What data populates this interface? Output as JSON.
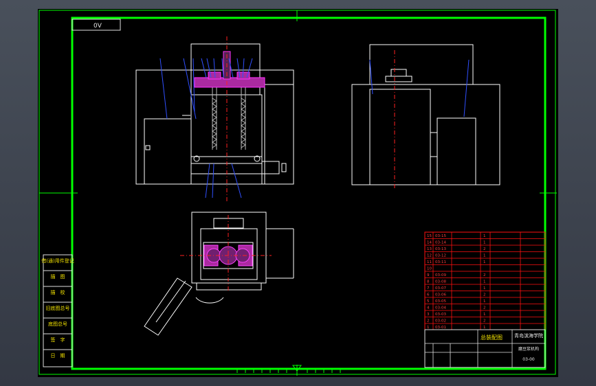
{
  "drawing_tag": "0V",
  "left_labels": [
    "借(通)用件登记",
    "描　图",
    "描　校",
    "旧底图总号",
    "底图总号",
    "签　字",
    "日　期"
  ],
  "bom_header": "总装配图",
  "school": "青岛滨海学院",
  "product": "磨豆浆机构",
  "drawing_no": "03-00",
  "bom_rows": [
    {
      "no": "15",
      "code": "03-15",
      "qty": "1"
    },
    {
      "no": "14",
      "code": "03-14",
      "qty": "1"
    },
    {
      "no": "13",
      "code": "03-13",
      "qty": "2"
    },
    {
      "no": "12",
      "code": "03-12",
      "qty": "1"
    },
    {
      "no": "11",
      "code": "03-11",
      "qty": "1"
    },
    {
      "no": "10",
      "code": "",
      "qty": ""
    },
    {
      "no": "9",
      "code": "03-09",
      "qty": "2"
    },
    {
      "no": "8",
      "code": "03-08",
      "qty": "1"
    },
    {
      "no": "7",
      "code": "03-07",
      "qty": "1"
    },
    {
      "no": "6",
      "code": "03-06",
      "qty": "2"
    },
    {
      "no": "5",
      "code": "03-05",
      "qty": "1"
    },
    {
      "no": "4",
      "code": "03-04",
      "qty": "2"
    },
    {
      "no": "3",
      "code": "03-03",
      "qty": "1"
    },
    {
      "no": "2",
      "code": "03-02",
      "qty": "2"
    },
    {
      "no": "1",
      "code": "03-01",
      "qty": "1"
    }
  ],
  "colors": {
    "frame": "#00ff00",
    "drawing": "#ffffff",
    "table": "#ff0000",
    "leader": "#2040ff",
    "part": "#ff00ff",
    "centerline": "#ff2020"
  }
}
